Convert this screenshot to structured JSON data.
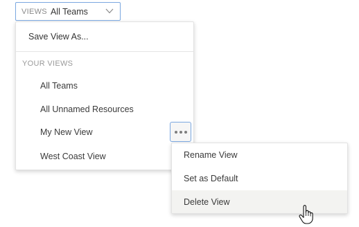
{
  "views_select": {
    "prefix": "VIEWS",
    "value": "All Teams",
    "icon": "chevron-down-icon"
  },
  "dropdown": {
    "save_label": "Save View As...",
    "section_label": "YOUR VIEWS",
    "views": [
      {
        "label": "All Teams"
      },
      {
        "label": "All Unnamed Resources"
      },
      {
        "label": "My New View"
      },
      {
        "label": "West Coast View"
      }
    ],
    "more_icon": "ellipsis-icon"
  },
  "context_menu": {
    "items": [
      {
        "label": "Rename View"
      },
      {
        "label": "Set as Default"
      },
      {
        "label": "Delete View",
        "state": "hovered"
      }
    ]
  },
  "colors": {
    "accent_border": "#7aa7e0",
    "hover_bg": "#f3f3f1",
    "muted_text": "#9a9a9a"
  }
}
